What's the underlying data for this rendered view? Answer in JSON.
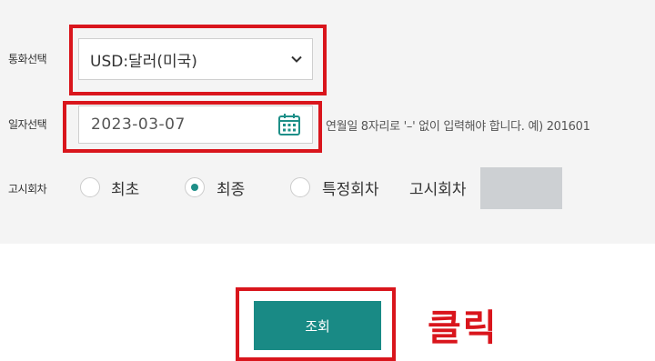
{
  "form": {
    "currency_label": "통화선택",
    "currency_value": "USD:달러(미국)",
    "date_label": "일자선택",
    "date_value": "2023-03-07",
    "date_hint": "연월일 8자리로 '–' 없이 입력해야 합니다. 예) 201601",
    "round_label": "고시회차",
    "round_options": [
      "최초",
      "최종",
      "특정회차"
    ],
    "round_selected": "최종",
    "round_input_label": "고시회차",
    "query_button": "조회"
  },
  "annotation": {
    "click_text": "클릭",
    "color": "#d9151c"
  },
  "colors": {
    "accent": "#198a85",
    "panel_bg": "#f4f4f4"
  }
}
